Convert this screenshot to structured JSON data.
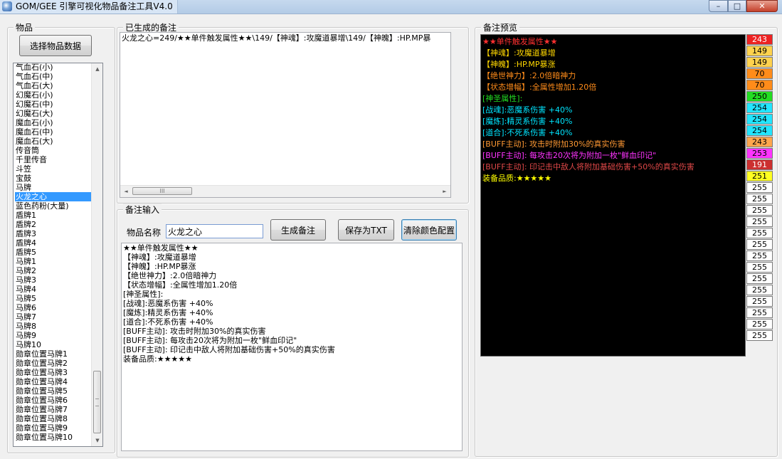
{
  "window": {
    "title": "GOM/GEE 引擎可视化物品备注工具V4.0"
  },
  "items_group": {
    "label": "物品",
    "select_button": "选择物品数据",
    "items": [
      "气血石(小)",
      "气血石(中)",
      "气血石(大)",
      "幻魔石(小)",
      "幻魔石(中)",
      "幻魔石(大)",
      "魔血石(小)",
      "魔血石(中)",
      "魔血石(大)",
      "传音筒",
      "千里传音",
      "斗笠",
      "宝鼓",
      "马牌",
      "火龙之心",
      "蓝色药粉(大量)",
      "盾牌1",
      "盾牌2",
      "盾牌3",
      "盾牌4",
      "盾牌5",
      "马牌1",
      "马牌2",
      "马牌3",
      "马牌4",
      "马牌5",
      "马牌6",
      "马牌7",
      "马牌8",
      "马牌9",
      "马牌10",
      "勋章位置马牌1",
      "勋章位置马牌2",
      "勋章位置马牌3",
      "勋章位置马牌4",
      "勋章位置马牌5",
      "勋章位置马牌6",
      "勋章位置马牌7",
      "勋章位置马牌8",
      "勋章位置马牌9",
      "勋章位置马牌10"
    ],
    "selected_index": 14
  },
  "generated_group": {
    "label": "已生成的备注",
    "text": "火龙之心=249/★★单件触发属性★★\\149/【神魂】:攻魔道暴增\\149/【神魄】:HP.MP暴"
  },
  "input_group": {
    "label": "备注输入",
    "name_label": "物品名称",
    "name_value": "火龙之心",
    "generate_button": "生成备注",
    "save_button": "保存为TXT",
    "clear_button": "清除颜色配置",
    "lines": [
      "★★单件触发属性★★",
      "【神魂】:攻魔道暴增",
      "【神魄】:HP.MP暴涨",
      "【绝世神力】:2.0倍暗神力",
      "【状态增幅】:全属性增加1.20倍",
      "[神圣属性]:",
      "[战魂]:恶魔系伤害 +40%",
      "[魔炼]:精灵系伤害 +40%",
      "[道合]:不死系伤害 +40%",
      "[BUFF主动]: 攻击时附加30%的真实伤害",
      "[BUFF主动]: 每攻击20次将为附加一枚\"鲜血印记\"",
      "[BUFF主动]: 印记击中敌人将附加基础伤害+50%的真实伤害",
      "装备品质:★★★★★"
    ]
  },
  "preview_group": {
    "label": "备注预览",
    "lines": [
      {
        "text": "★★单件触发属性★★",
        "color": "#ff3030"
      },
      {
        "text": "【神魂】:攻魔道暴增",
        "color": "#ffd700"
      },
      {
        "text": "【神魄】:HP.MP暴涨",
        "color": "#ffd700"
      },
      {
        "text": "【绝世神力】:2.0倍暗神力",
        "color": "#ff8c1a"
      },
      {
        "text": "【状态增幅】:全属性增加1.20倍",
        "color": "#ff8c1a"
      },
      {
        "text": "[神圣属性]:",
        "color": "#22dd22"
      },
      {
        "text": "[战魂]:恶魔系伤害 +40%",
        "color": "#00e5ff"
      },
      {
        "text": "[魔炼]:精灵系伤害 +40%",
        "color": "#00e5ff"
      },
      {
        "text": "[道合]:不死系伤害 +40%",
        "color": "#00e5ff"
      },
      {
        "text": "[BUFF主动]: 攻击时附加30%的真实伤害",
        "color": "#ff9933"
      },
      {
        "text": "[BUFF主动]: 每攻击20次将为附加一枚\"鲜血印记\"",
        "color": "#ff33ff"
      },
      {
        "text": "[BUFF主动]: 印记击中敌人将附加基础伤害+50%的真实伤害",
        "color": "#e04848"
      },
      {
        "text": "装备品质:★★★★★",
        "color": "#ffff00"
      }
    ],
    "color_codes": [
      {
        "value": "243",
        "bg": "#ee2222",
        "fg": "#ffffff"
      },
      {
        "value": "149",
        "bg": "#ffd24d",
        "fg": "#000000"
      },
      {
        "value": "149",
        "bg": "#ffd24d",
        "fg": "#000000"
      },
      {
        "value": "70",
        "bg": "#ff8c1a",
        "fg": "#000000"
      },
      {
        "value": "70",
        "bg": "#ff8c1a",
        "fg": "#000000"
      },
      {
        "value": "250",
        "bg": "#22dd22",
        "fg": "#000000"
      },
      {
        "value": "254",
        "bg": "#22e5ff",
        "fg": "#000000"
      },
      {
        "value": "254",
        "bg": "#22e5ff",
        "fg": "#000000"
      },
      {
        "value": "254",
        "bg": "#22e5ff",
        "fg": "#000000"
      },
      {
        "value": "243",
        "bg": "#ffa64d",
        "fg": "#000000"
      },
      {
        "value": "253",
        "bg": "#ff33ff",
        "fg": "#000000"
      },
      {
        "value": "191",
        "bg": "#cc3030",
        "fg": "#ffffff"
      },
      {
        "value": "251",
        "bg": "#ffff22",
        "fg": "#000000"
      },
      {
        "value": "255",
        "bg": "#ffffff",
        "fg": "#000000"
      },
      {
        "value": "255",
        "bg": "#ffffff",
        "fg": "#000000"
      },
      {
        "value": "255",
        "bg": "#ffffff",
        "fg": "#000000"
      },
      {
        "value": "255",
        "bg": "#ffffff",
        "fg": "#000000"
      },
      {
        "value": "255",
        "bg": "#ffffff",
        "fg": "#000000"
      },
      {
        "value": "255",
        "bg": "#ffffff",
        "fg": "#000000"
      },
      {
        "value": "255",
        "bg": "#ffffff",
        "fg": "#000000"
      },
      {
        "value": "255",
        "bg": "#ffffff",
        "fg": "#000000"
      },
      {
        "value": "255",
        "bg": "#ffffff",
        "fg": "#000000"
      },
      {
        "value": "255",
        "bg": "#ffffff",
        "fg": "#000000"
      },
      {
        "value": "255",
        "bg": "#ffffff",
        "fg": "#000000"
      },
      {
        "value": "255",
        "bg": "#ffffff",
        "fg": "#000000"
      },
      {
        "value": "255",
        "bg": "#ffffff",
        "fg": "#000000"
      },
      {
        "value": "255",
        "bg": "#ffffff",
        "fg": "#000000"
      }
    ]
  },
  "icons": {
    "scroll_up": "▲",
    "scroll_down": "▼",
    "scroll_left": "◄",
    "scroll_right": "►",
    "thumb_grip": "III",
    "minimize": "–",
    "maximize": "□",
    "close": "✕"
  }
}
